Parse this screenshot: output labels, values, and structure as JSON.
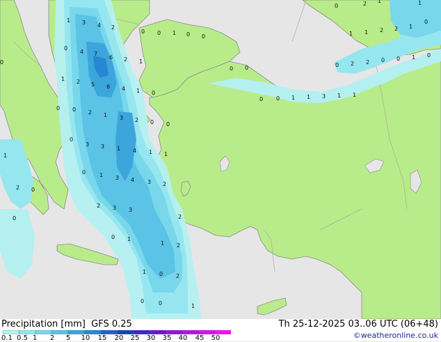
{
  "footer": {
    "title": "Precipitation [mm]  GFS 0.25",
    "valid": "Th 25-12-2025 03..06 UTC (06+48)",
    "credit": "©weatheronline.co.uk"
  },
  "legend": {
    "ticks": [
      "0.1",
      "0.5",
      "1",
      "2",
      "5",
      "10",
      "15",
      "20",
      "25",
      "30",
      "35",
      "40",
      "45",
      "50"
    ],
    "colors": [
      "#b4f0f0",
      "#96e6f0",
      "#78d7eb",
      "#5ac3e6",
      "#3ca5dc",
      "#2887d2",
      "#1e64c8",
      "#1446b4",
      "#3c28c8",
      "#6e14d2",
      "#9614dc",
      "#b414e6",
      "#d214f0",
      "#f014f0"
    ]
  },
  "map": {
    "colors": {
      "land": "#b8ec8a",
      "sea": "#e6e6e6",
      "border": "#aaaaaa",
      "coast": "#8a8a8a"
    },
    "labels": [
      {
        "t": "3"
      },
      {
        "t": "4"
      },
      {
        "t": "2"
      },
      {
        "t": "0"
      },
      {
        "t": "0"
      },
      {
        "t": "1"
      },
      {
        "t": "0"
      },
      {
        "t": "0"
      },
      {
        "t": "0"
      },
      {
        "t": "2"
      },
      {
        "t": "1"
      },
      {
        "t": "0"
      },
      {
        "t": "4"
      },
      {
        "t": "7"
      },
      {
        "t": "6"
      },
      {
        "t": "2"
      },
      {
        "t": "1"
      },
      {
        "t": "1"
      },
      {
        "t": "2"
      },
      {
        "t": "5"
      },
      {
        "t": "6"
      },
      {
        "t": "4"
      },
      {
        "t": "1"
      },
      {
        "t": "0"
      },
      {
        "t": "0"
      },
      {
        "t": "2"
      },
      {
        "t": "1"
      },
      {
        "t": "3"
      },
      {
        "t": "2"
      },
      {
        "t": "0"
      },
      {
        "t": "0"
      },
      {
        "t": "3"
      },
      {
        "t": "3"
      },
      {
        "t": "1"
      },
      {
        "t": "4"
      },
      {
        "t": "1"
      },
      {
        "t": "1"
      },
      {
        "t": "0"
      },
      {
        "t": "1"
      },
      {
        "t": "3"
      },
      {
        "t": "4"
      },
      {
        "t": "3"
      },
      {
        "t": "2"
      },
      {
        "t": "2"
      },
      {
        "t": "0"
      },
      {
        "t": "2"
      },
      {
        "t": "3"
      },
      {
        "t": "3"
      },
      {
        "t": "0"
      },
      {
        "t": "0"
      },
      {
        "t": "1"
      },
      {
        "t": "1"
      },
      {
        "t": "2"
      },
      {
        "t": "1"
      },
      {
        "t": "0"
      },
      {
        "t": "2"
      },
      {
        "t": "0"
      },
      {
        "t": "0"
      },
      {
        "t": "1"
      },
      {
        "t": "0"
      },
      {
        "t": "0"
      },
      {
        "t": "1"
      },
      {
        "t": "1"
      },
      {
        "t": "3"
      },
      {
        "t": "1"
      },
      {
        "t": "1"
      },
      {
        "t": "0"
      },
      {
        "t": "2"
      },
      {
        "t": "2"
      },
      {
        "t": "0"
      },
      {
        "t": "0"
      },
      {
        "t": "1"
      },
      {
        "t": "1"
      },
      {
        "t": "1"
      },
      {
        "t": "2"
      },
      {
        "t": "2"
      },
      {
        "t": "1"
      },
      {
        "t": "0"
      },
      {
        "t": "0"
      },
      {
        "t": "2"
      },
      {
        "t": "1"
      },
      {
        "t": "0"
      },
      {
        "t": "1"
      },
      {
        "t": "0"
      },
      {
        "t": "0"
      },
      {
        "t": "0"
      },
      {
        "t": "1"
      },
      {
        "t": "0"
      }
    ]
  }
}
